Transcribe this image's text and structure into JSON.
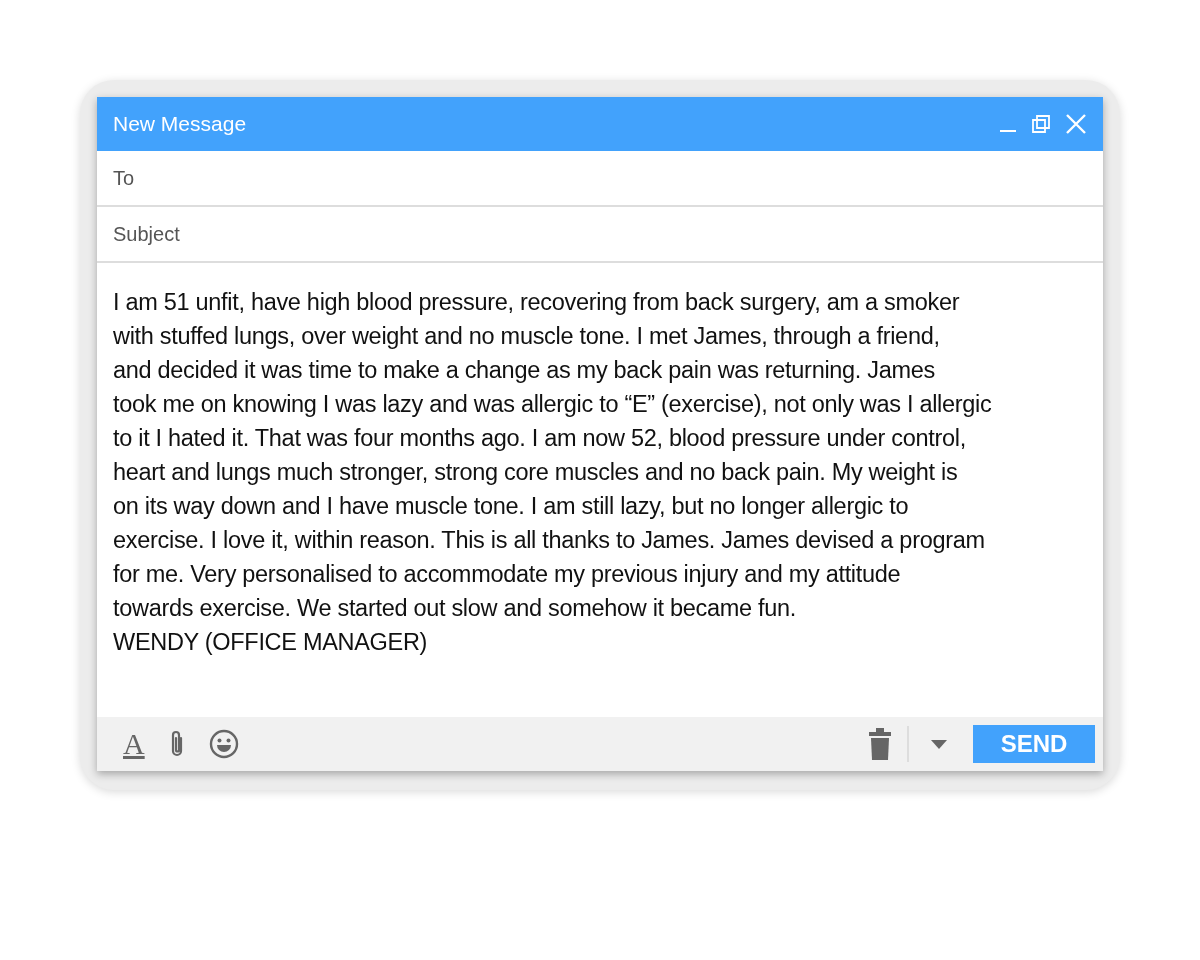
{
  "window": {
    "title": "New Message"
  },
  "fields": [
    {
      "placeholder": "To"
    },
    {
      "placeholder": "Subject"
    }
  ],
  "body": {
    "lines": [
      "I am 51 unfit, have high blood pressure, recovering from back surgery, am a smoker",
      "with stuffed lungs, over weight and no muscle tone. I met James, through a friend,",
      "and decided it was time to make a change as my back pain was returning. James",
      "took me on knowing I was lazy and was allergic to “E” (exercise), not only was I allergic",
      "to it I hated it. That was four months ago. I am now 52, blood pressure under control,",
      "heart and lungs much stronger, strong core muscles and no back pain. My weight is",
      "on its way down and I have muscle tone. I am still lazy, but no longer allergic to",
      "exercise. I love it, within reason. This is all thanks to James. James devised a program",
      "for me. Very personalised to accommodate my previous injury and my attitude",
      "towards exercise. We started out slow and somehow it became fun."
    ],
    "signature": "WENDY (OFFICE MANAGER)"
  },
  "toolbar": {
    "format_glyph": "A",
    "send_label": "SEND"
  }
}
